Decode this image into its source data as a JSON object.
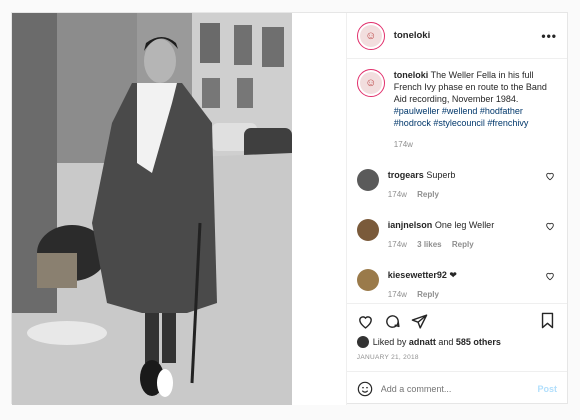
{
  "post": {
    "username": "toneloki",
    "more_label": "•••",
    "caption_text": "The Weller Fella in his full French Ivy phase en route to the Band Aid recording, November 1984.",
    "hashtags": "#paulweller #wellend #hodfather #hodrock #stylecouncil #frenchivy",
    "caption_age": "174w"
  },
  "comments": [
    {
      "user": "trogears",
      "text": "Superb",
      "age": "174w",
      "likes": "",
      "reply": "Reply"
    },
    {
      "user": "ianjnelson",
      "text": "One leg Weller",
      "age": "174w",
      "likes": "3 likes",
      "reply": "Reply"
    },
    {
      "user": "kiesewetter92",
      "text": "❤",
      "age": "174w",
      "likes": "",
      "reply": "Reply"
    }
  ],
  "likes": {
    "prefix": "Liked by",
    "by": "adnatt",
    "and": "and",
    "others": "585 others"
  },
  "date": "JANUARY 21, 2018",
  "add_comment": {
    "placeholder": "Add a comment...",
    "post_label": "Post"
  },
  "icons": {
    "like": "heart-icon",
    "comment": "comment-bubble-icon",
    "share": "paper-plane-icon",
    "save": "bookmark-icon",
    "emoji": "emoji-icon"
  },
  "colors": {
    "hashtag": "#00376b",
    "post_disabled": "#b2dffc",
    "meta": "#8e8e8e"
  }
}
